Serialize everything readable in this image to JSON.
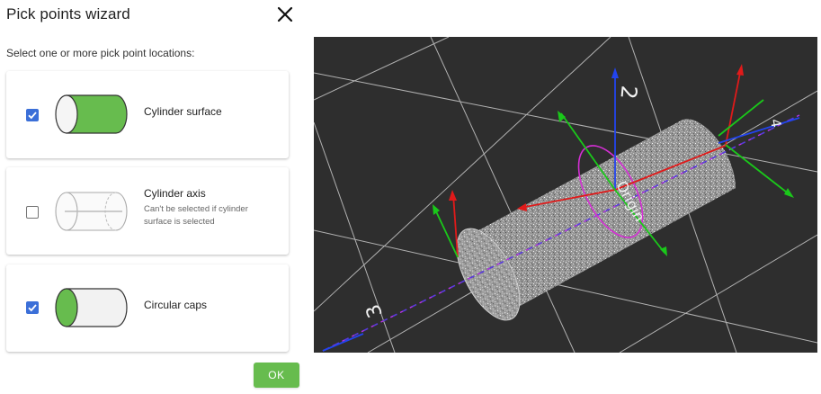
{
  "dialog": {
    "title": "Pick points wizard",
    "subtitle": "Select one or more pick point locations:",
    "ok_label": "OK"
  },
  "options": [
    {
      "label": "Cylinder surface",
      "checked": true,
      "icon": "cylinder-surface-icon"
    },
    {
      "label": "Cylinder axis",
      "checked": false,
      "note": "Can't be selected if cylinder surface is selected",
      "icon": "cylinder-axis-icon"
    },
    {
      "label": "Circular caps",
      "checked": true,
      "icon": "circular-caps-icon"
    }
  ],
  "viewer": {
    "labels": {
      "top_axis": "2",
      "right_axis": "4",
      "bottom_axis": "3",
      "origin": "Origin"
    }
  },
  "colors": {
    "accent": "#3b6fd8",
    "green": "#67bc4e",
    "viewer_bg": "#2e2e2e",
    "axis_x": "#e01a1a",
    "axis_y": "#1ac81a",
    "axis_z": "#1f3bd6",
    "circle": "#d42fd4"
  }
}
